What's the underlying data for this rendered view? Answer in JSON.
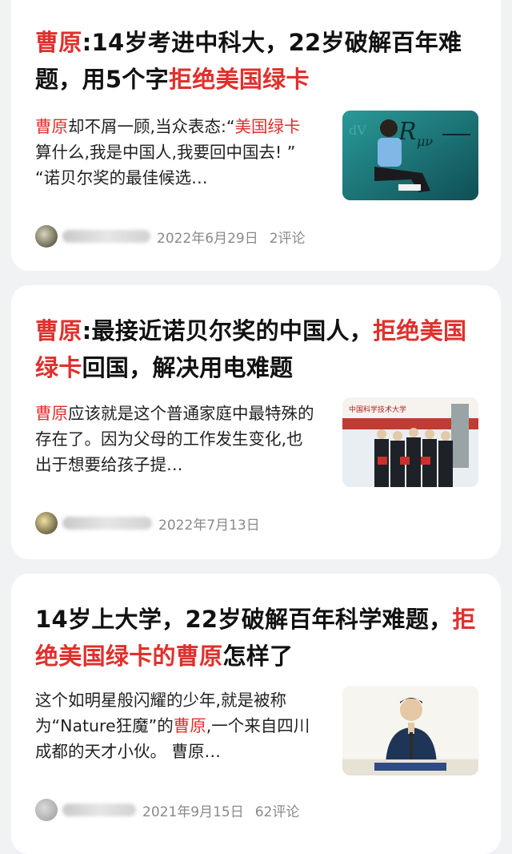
{
  "articles": [
    {
      "title_parts": [
        {
          "text": "曹原",
          "hl": true
        },
        {
          "text": ":14岁考进中科大，22岁破解百年难题，用5个字",
          "hl": false
        },
        {
          "text": "拒绝美国绿卡",
          "hl": true
        }
      ],
      "snippet_parts": [
        {
          "text": "曹原",
          "hl": true
        },
        {
          "text": "却不屑一顾,当众表态:“",
          "hl": false
        },
        {
          "text": "美国绿卡",
          "hl": true
        },
        {
          "text": "算什么,我是中国人,我要回中国去! ” “诺贝尔奖的最佳候选…",
          "hl": false
        }
      ],
      "date": "2022年6月29日",
      "comments": "2评论",
      "thumb": "man-seated-before-formula-board"
    },
    {
      "title_parts": [
        {
          "text": "曹原",
          "hl": true
        },
        {
          "text": ":最接近诺贝尔奖的中国人，",
          "hl": false
        },
        {
          "text": "拒绝美国绿卡",
          "hl": true
        },
        {
          "text": "回国，解决用电难题",
          "hl": false
        }
      ],
      "snippet_parts": [
        {
          "text": "曹原",
          "hl": true
        },
        {
          "text": "应该就是这个普通家庭中最特殊的存在了。因为父母的工作发生变化,也出于想要给孩子提…",
          "hl": false
        }
      ],
      "date": "2022年7月13日",
      "comments": "",
      "thumb": "award-ceremony-group"
    },
    {
      "title_parts": [
        {
          "text": "14岁上大学，22岁破解百年科学难题，",
          "hl": false
        },
        {
          "text": "拒绝美国绿卡的曹原",
          "hl": true
        },
        {
          "text": "怎样了",
          "hl": false
        }
      ],
      "snippet_parts": [
        {
          "text": "这个如明星般闪耀的少年,就是被称为“Nature狂魔”的",
          "hl": false
        },
        {
          "text": "曹原",
          "hl": true
        },
        {
          "text": ",一个来自四川成都的天才小伙。 曹原…",
          "hl": false
        }
      ],
      "date": "2021年9月15日",
      "comments": "62评论",
      "thumb": "man-speaking-at-podium"
    }
  ],
  "colors": {
    "highlight": "#e0302c",
    "text": "#111111",
    "meta": "#8a8a8a",
    "background": "#f1f2f4"
  }
}
